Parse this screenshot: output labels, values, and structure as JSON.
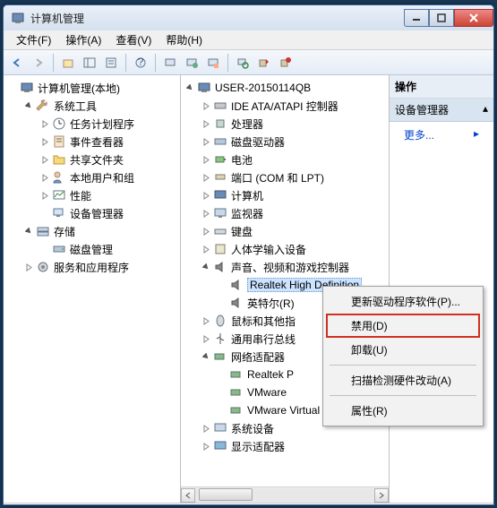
{
  "window": {
    "title": "计算机管理"
  },
  "menu": {
    "file": "文件(F)",
    "action": "操作(A)",
    "view": "查看(V)",
    "help": "帮助(H)"
  },
  "left_tree": {
    "root": "计算机管理(本地)",
    "system_tools": "系统工具",
    "task_scheduler": "任务计划程序",
    "event_viewer": "事件查看器",
    "shared_folders": "共享文件夹",
    "local_users": "本地用户和组",
    "performance": "性能",
    "device_manager": "设备管理器",
    "storage": "存储",
    "disk_mgmt": "磁盘管理",
    "services": "服务和应用程序"
  },
  "mid_tree": {
    "root": "USER-20150114QB",
    "ide": "IDE ATA/ATAPI 控制器",
    "cpu": "处理器",
    "disk": "磁盘驱动器",
    "battery": "电池",
    "ports": "端口 (COM 和 LPT)",
    "computer": "计算机",
    "monitor": "监视器",
    "keyboard": "键盘",
    "hid": "人体学输入设备",
    "sound": "声音、视频和游戏控制器",
    "realtek_hd": "Realtek High Definition",
    "intel_r": "英特尔(R)",
    "mouse": "鼠标和其他指",
    "usb": "通用串行总线",
    "network": "网络适配器",
    "realtek_p": "Realtek P",
    "vmware1": "VMware",
    "vmware2": "VMware Virtual Etherne",
    "sysdev": "系统设备",
    "display": "显示适配器"
  },
  "actions": {
    "header": "操作",
    "sub": "设备管理器",
    "more": "更多..."
  },
  "context": {
    "update": "更新驱动程序软件(P)...",
    "disable": "禁用(D)",
    "uninstall": "卸载(U)",
    "scan": "扫描检测硬件改动(A)",
    "properties": "属性(R)"
  }
}
